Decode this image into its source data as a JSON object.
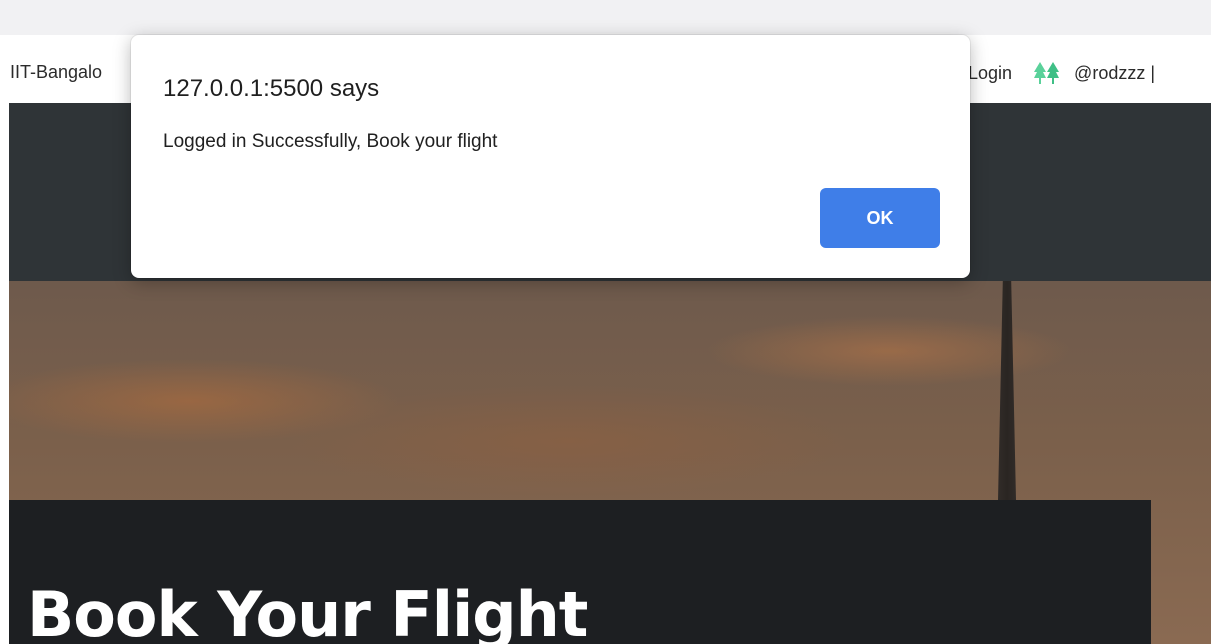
{
  "bookmarks": {
    "left_item": "IIT-Bangalo",
    "login": "Login",
    "account": "@rodzzz |"
  },
  "alert": {
    "title": "127.0.0.1:5500 says",
    "message": "Logged in Successfully, Book your flight",
    "ok_label": "OK"
  },
  "hero": {
    "title": "Book Your Flight"
  },
  "icons": {
    "bookmark_icon": "trees-icon"
  },
  "colors": {
    "ok_button": "#3f7ee8",
    "nav": "#2f3437",
    "hero_panel": "#1d1f22",
    "trees_icon": "#5ad19a"
  }
}
